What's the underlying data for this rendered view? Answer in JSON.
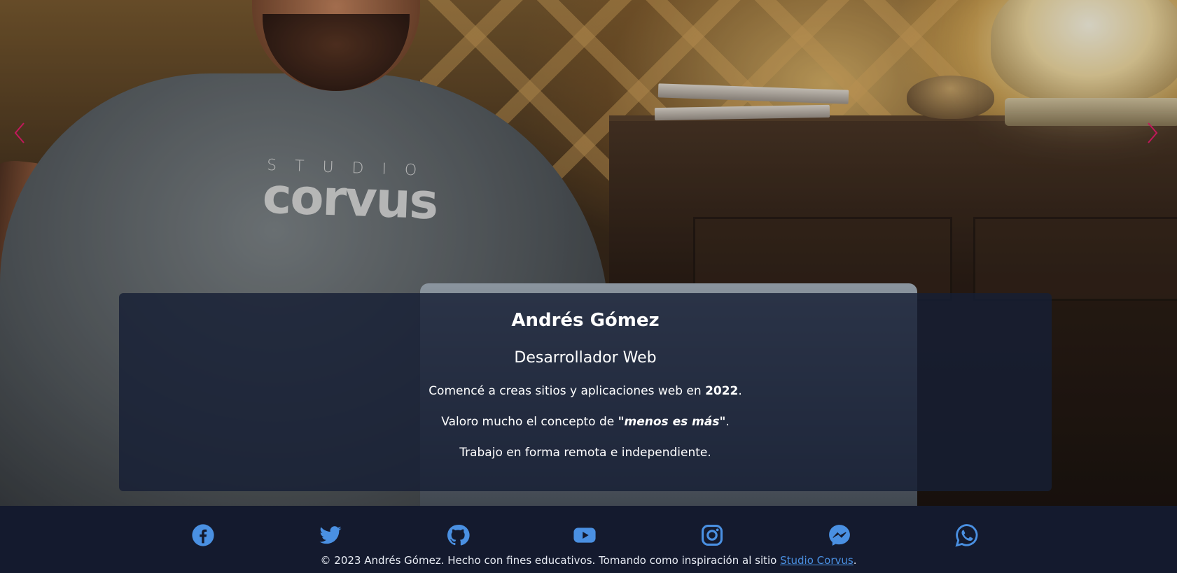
{
  "carousel": {
    "prev_icon": "chevron-left-icon",
    "next_icon": "chevron-right-icon",
    "arrow_color": "#c2185b",
    "shirt_text_small": "STUDIO",
    "shirt_text_big": "corvus"
  },
  "caption": {
    "name": "Andrés Gómez",
    "role": "Desarrollador Web",
    "line1_prefix": "Comencé a creas sitios y aplicaciones web en ",
    "line1_year": "2022",
    "line1_suffix": ".",
    "line2_prefix": "Valoro mucho el concepto de ",
    "line2_emphasis": "\"menos es más\"",
    "line2_suffix": ".",
    "line3": "Trabajo en forma remota e independiente."
  },
  "footer": {
    "social_links": [
      {
        "icon": "facebook-icon"
      },
      {
        "icon": "twitter-icon"
      },
      {
        "icon": "github-icon"
      },
      {
        "icon": "youtube-icon"
      },
      {
        "icon": "instagram-icon"
      },
      {
        "icon": "messenger-icon"
      },
      {
        "icon": "whatsapp-icon"
      }
    ],
    "icon_color": "#4a90e2",
    "copyright_text": "© 2023 Andrés Gómez. Hecho con fines educativos. Tomando como inspiración al sitio ",
    "link_text": "Studio Corvus",
    "copyright_suffix": ".",
    "background": "#141a2e"
  }
}
